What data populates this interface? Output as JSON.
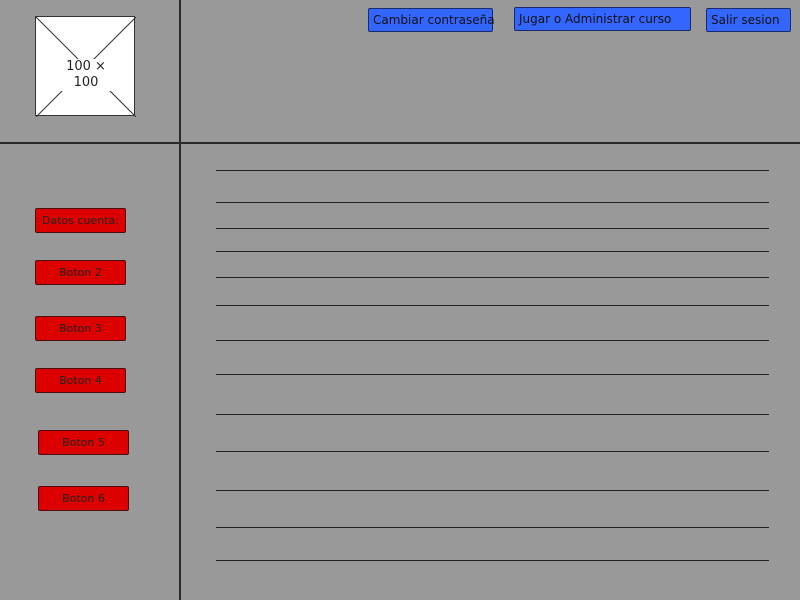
{
  "header": {
    "image_placeholder_label": "100 × 100",
    "buttons": [
      {
        "label": "Cambiar contraseña"
      },
      {
        "label": "Jugar o Administrar curso"
      },
      {
        "label": "Salir sesion"
      }
    ]
  },
  "sidebar": {
    "buttons": [
      {
        "label": "Datos cuenta:"
      },
      {
        "label": "Boton 2"
      },
      {
        "label": "Boton 3"
      },
      {
        "label": "Boton 4"
      },
      {
        "label": "Boton 5"
      },
      {
        "label": "Boton 6"
      }
    ]
  },
  "colors": {
    "background": "#999999",
    "header_button": "#3366ff",
    "sidebar_button": "#dd0000"
  }
}
